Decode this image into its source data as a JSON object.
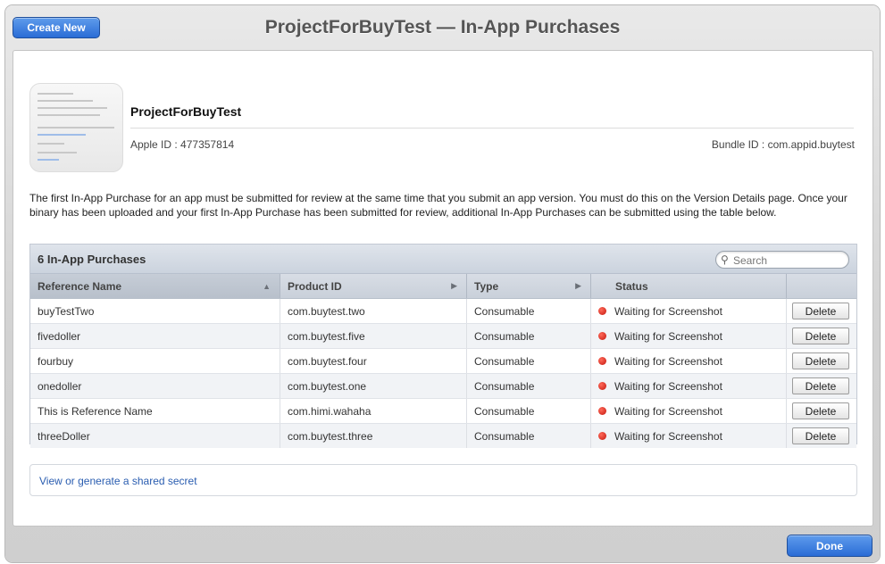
{
  "header": {
    "create_label": "Create New",
    "title": "ProjectForBuyTest — In-App Purchases"
  },
  "app": {
    "name": "ProjectForBuyTest",
    "apple_id_label": "Apple ID :",
    "apple_id": "477357814",
    "bundle_id_label": "Bundle ID :",
    "bundle_id": "com.appid.buytest"
  },
  "notice": "The first In-App Purchase for an app must be submitted for review at the same time that you submit an app version. You must do this on the Version Details page. Once your binary has been uploaded and your first In-App Purchase has been submitted for review, additional In-App Purchases can be submitted using the table below.",
  "table": {
    "count_label": "6 In-App Purchases",
    "search_placeholder": "Search",
    "columns": [
      "Reference Name",
      "Product ID",
      "Type",
      "Status"
    ],
    "rows": [
      {
        "name": "buyTestTwo",
        "product_id": "com.buytest.two",
        "type": "Consumable",
        "status": "Waiting for Screenshot",
        "action": "Delete"
      },
      {
        "name": "fivedoller",
        "product_id": "com.buytest.five",
        "type": "Consumable",
        "status": "Waiting for Screenshot",
        "action": "Delete"
      },
      {
        "name": "fourbuy",
        "product_id": "com.buytest.four",
        "type": "Consumable",
        "status": "Waiting for Screenshot",
        "action": "Delete"
      },
      {
        "name": "onedoller",
        "product_id": "com.buytest.one",
        "type": "Consumable",
        "status": "Waiting for Screenshot",
        "action": "Delete"
      },
      {
        "name": "This is Reference Name",
        "product_id": "com.himi.wahaha",
        "type": "Consumable",
        "status": "Waiting for Screenshot",
        "action": "Delete"
      },
      {
        "name": "threeDoller",
        "product_id": "com.buytest.three",
        "type": "Consumable",
        "status": "Waiting for Screenshot",
        "action": "Delete"
      }
    ]
  },
  "secret_link": "View or generate a shared secret",
  "footer": {
    "done_label": "Done"
  },
  "colors": {
    "accent": "#2a6cd6",
    "status_red": "#c4160d",
    "link": "#2a5db0"
  },
  "icons": {
    "search": "search-icon",
    "sort_up": "sort-ascending-icon",
    "sort_right": "sort-indicator-icon",
    "status": "status-red-dot-icon"
  }
}
